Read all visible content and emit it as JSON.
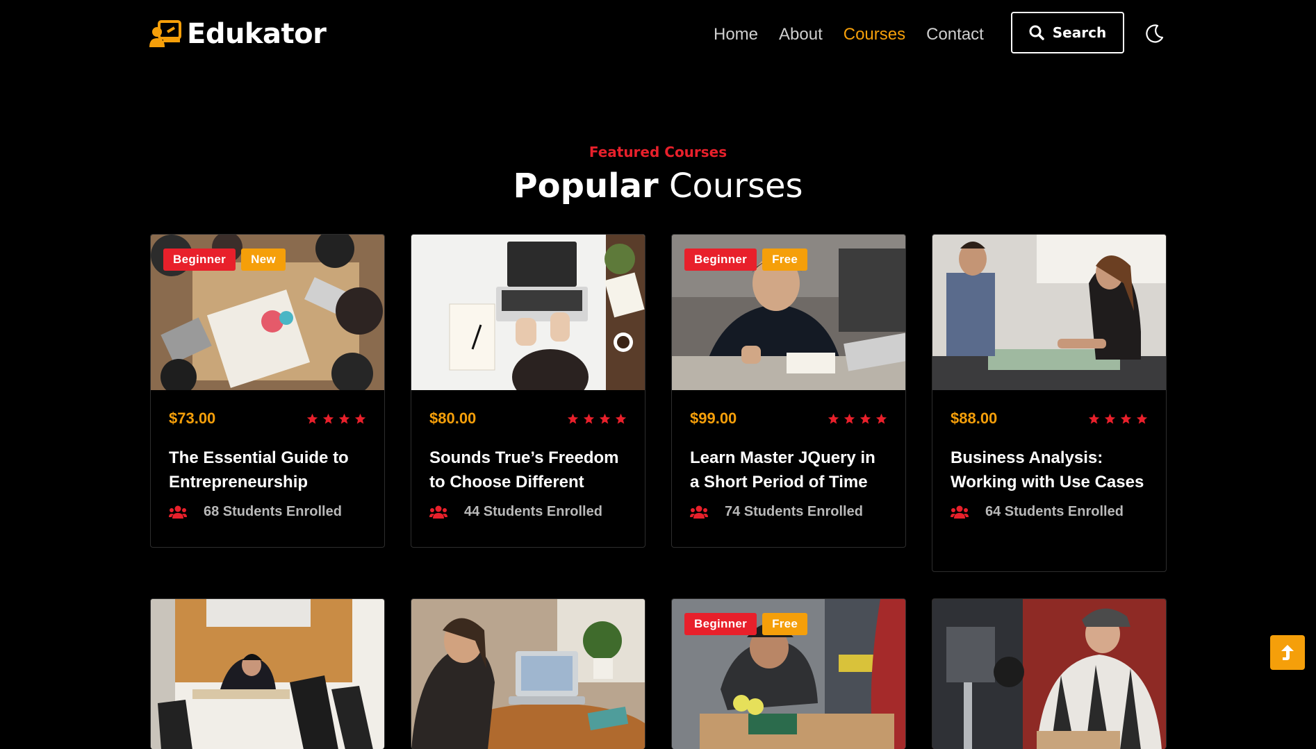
{
  "brand": {
    "name": "Edukator",
    "accent": "#f59f0a",
    "red": "#e8202b"
  },
  "nav": {
    "items": [
      {
        "label": "Home"
      },
      {
        "label": "About"
      },
      {
        "label": "Courses"
      },
      {
        "label": "Contact"
      }
    ],
    "active": "Courses"
  },
  "search": {
    "label": "Search",
    "icon": "search-icon"
  },
  "theme_toggle": {
    "icon": "moon-icon"
  },
  "section": {
    "subtitle": "Featured Courses",
    "title_bold": "Popular",
    "title_rest": "Courses"
  },
  "courses": [
    {
      "badges": [
        "Beginner",
        "New"
      ],
      "price": "$73.00",
      "rating": 4,
      "title": "The Essential Guide to Entrepreneurship",
      "enrolled": "68 Students Enrolled"
    },
    {
      "badges": [],
      "price": "$80.00",
      "rating": 4,
      "title": "Sounds True’s Freedom to Choose Different",
      "enrolled": "44 Students Enrolled"
    },
    {
      "badges": [
        "Beginner",
        "Free"
      ],
      "price": "$99.00",
      "rating": 4,
      "title": "Learn Master JQuery in a Short Period of Time",
      "enrolled": "74 Students Enrolled"
    },
    {
      "badges": [],
      "price": "$88.00",
      "rating": 4,
      "title": "Business Analysis: Working with Use Cases",
      "enrolled": "64 Students Enrolled"
    },
    {
      "badges": []
    },
    {
      "badges": []
    },
    {
      "badges": [
        "Beginner",
        "Free"
      ]
    },
    {
      "badges": []
    }
  ],
  "scroll_top": {
    "icon": "arrow-up-icon"
  }
}
